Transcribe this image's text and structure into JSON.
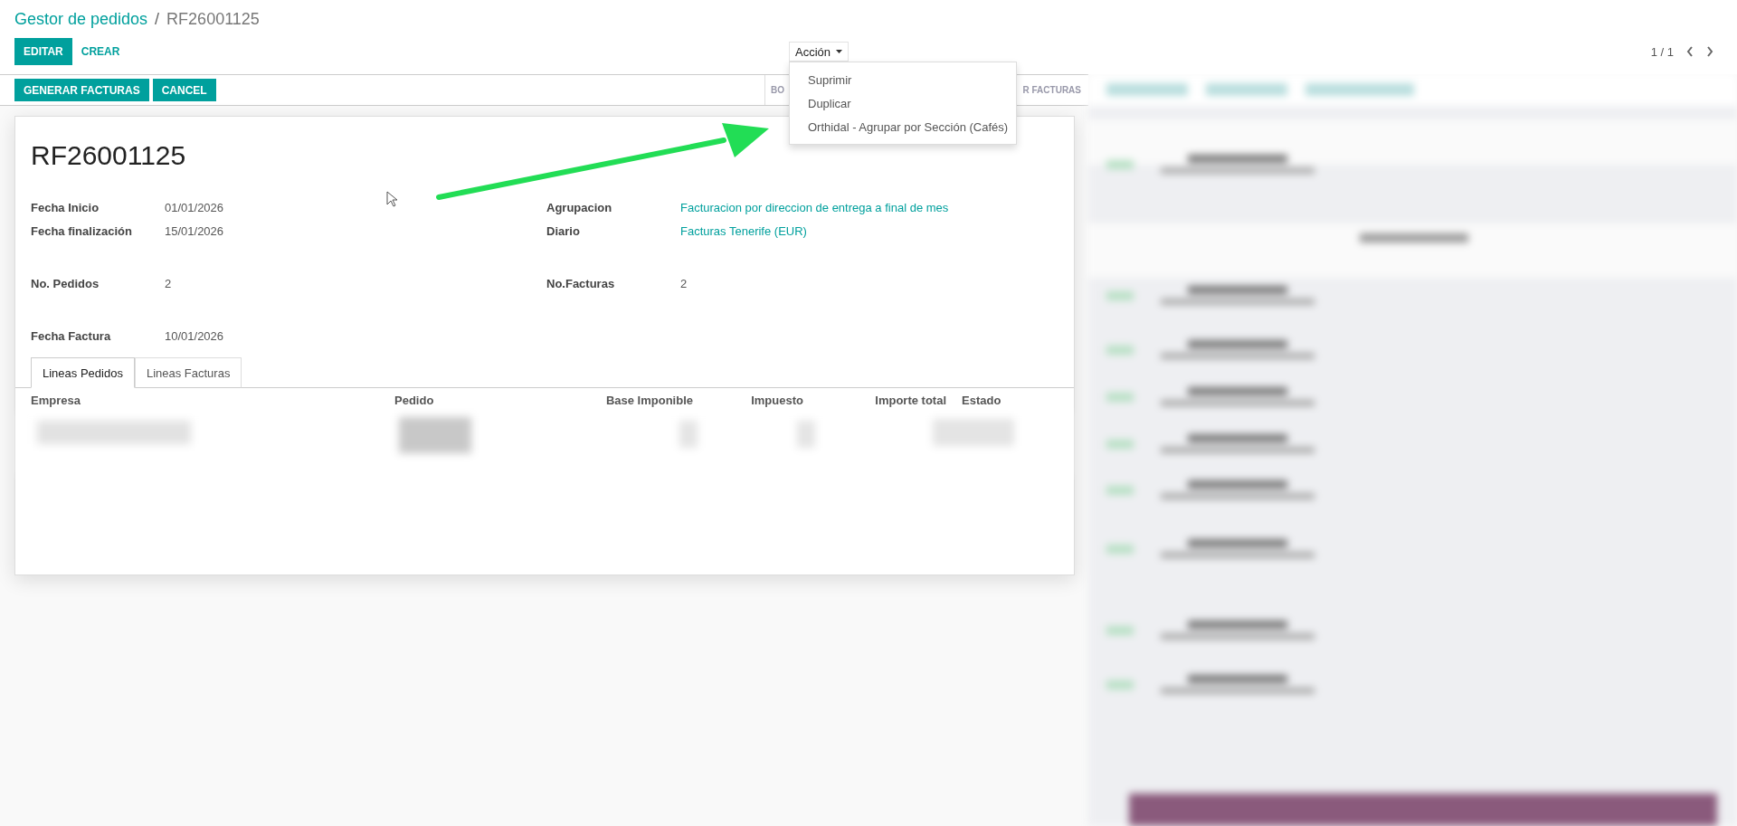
{
  "breadcrumb": {
    "parent": "Gestor de pedidos",
    "separator": "/",
    "current": "RF26001125"
  },
  "toolbar": {
    "buttons": [
      {
        "label": "EDITAR",
        "kind": "primary"
      },
      {
        "label": "CREAR",
        "kind": "link"
      }
    ],
    "action_menu": {
      "label": "Acción",
      "expanded": true,
      "items": [
        "Suprimir",
        "Duplicar",
        "Orthidal - Agrupar por Sección (Cafés)"
      ]
    },
    "pager": "1 / 1"
  },
  "status_bar": {
    "buttons": [
      "GENERAR FACTURAS",
      "CANCEL"
    ],
    "status_buttons": [
      "BO",
      "R FACTURAS"
    ]
  },
  "form": {
    "title": "RF26001125",
    "groups": [
      {
        "left": [
          {
            "label": "Fecha Inicio",
            "value": "01/01/2026",
            "link": false
          },
          {
            "label": "Fecha finalización",
            "value": "15/01/2026",
            "link": false
          }
        ],
        "right": [
          {
            "label": "Agrupacion",
            "value": "Facturacion por direccion de entrega a final de mes",
            "link": true
          },
          {
            "label": "Diario",
            "value": "Facturas Tenerife (EUR)",
            "link": true
          }
        ]
      },
      {
        "left": [
          {
            "label": "No. Pedidos",
            "value": "2",
            "link": false
          }
        ],
        "right": [
          {
            "label": "No.Facturas",
            "value": "2",
            "link": false
          }
        ]
      },
      {
        "left": [
          {
            "label": "Fecha Factura",
            "value": "10/01/2026",
            "link": false
          }
        ]
      }
    ],
    "tabs": [
      {
        "label": "Lineas Pedidos",
        "selected": true
      },
      {
        "label": "Lineas Facturas",
        "selected": false
      }
    ],
    "table": {
      "columns": [
        {
          "label": "Empresa",
          "numeric": false
        },
        {
          "label": "Pedido",
          "numeric": false
        },
        {
          "label": "Base Imponible",
          "numeric": true
        },
        {
          "label": "Impuesto",
          "numeric": true
        },
        {
          "label": "Importe total",
          "numeric": true
        },
        {
          "label": "Estado",
          "numeric": false
        }
      ]
    }
  }
}
